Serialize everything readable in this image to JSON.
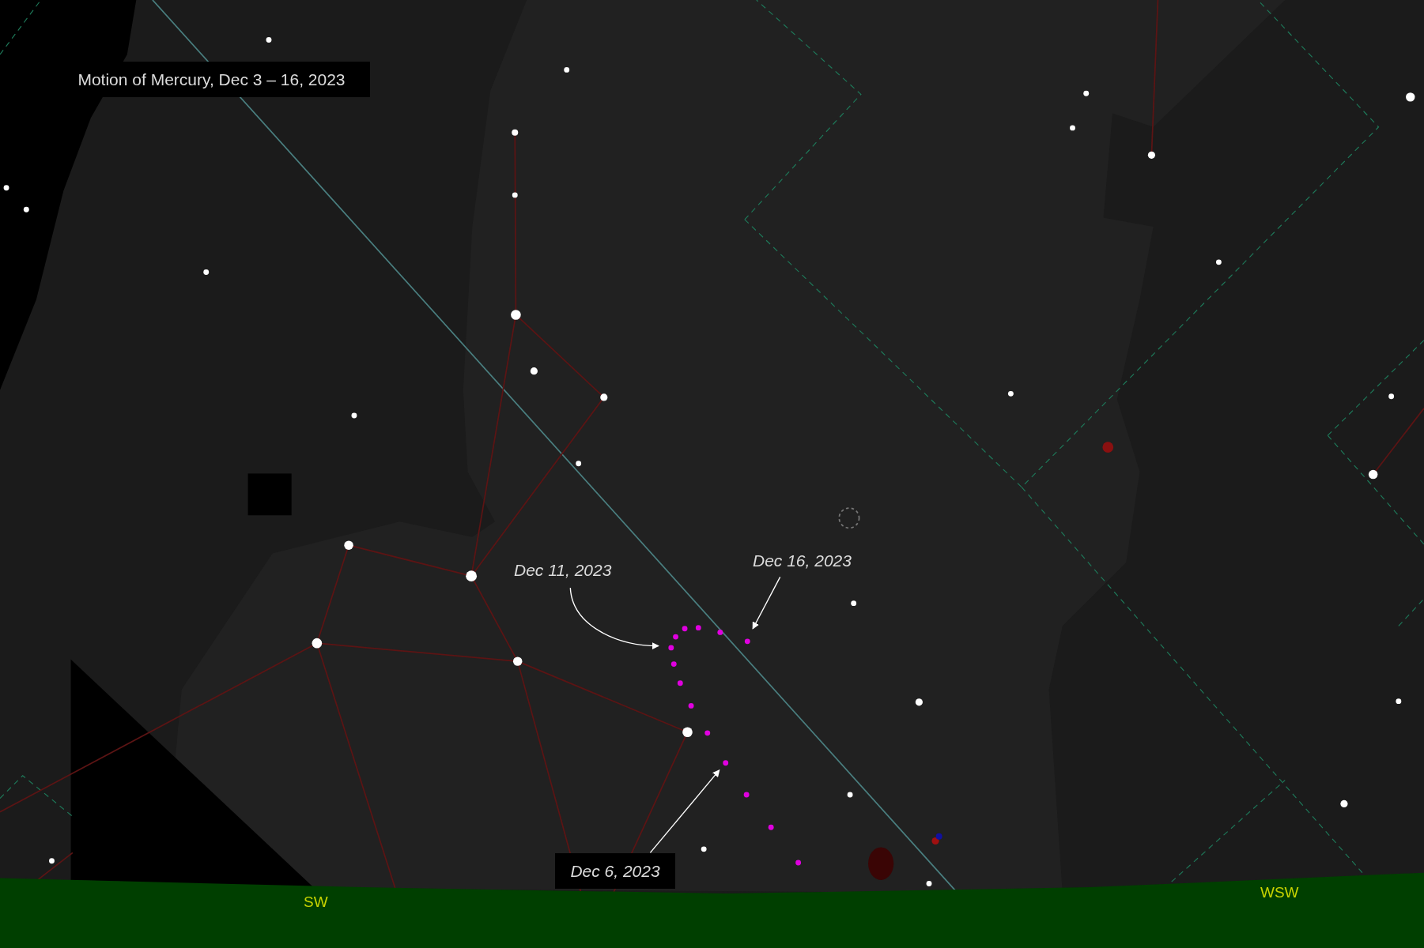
{
  "title": "Motion of Mercury, Dec 3 – 16, 2023",
  "date_labels": [
    {
      "text": "Dec 11, 2023",
      "boxed": false
    },
    {
      "text": "Dec 16, 2023",
      "boxed": false
    },
    {
      "text": "Dec 6, 2023",
      "boxed": true
    }
  ],
  "horizon_labels": [
    "SW",
    "WSW"
  ]
}
